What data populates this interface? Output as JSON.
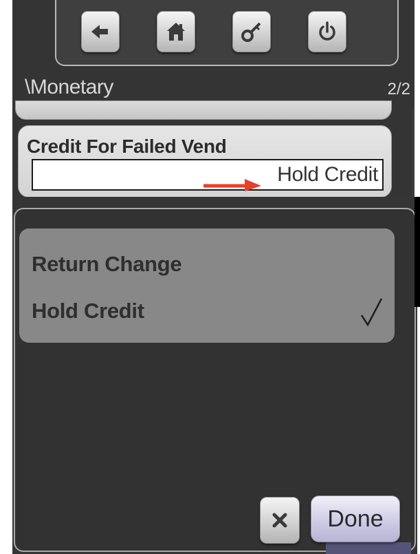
{
  "toolbar": {
    "buttons": [
      {
        "icon": "back-arrow-icon"
      },
      {
        "icon": "home-icon"
      },
      {
        "icon": "key-icon"
      },
      {
        "icon": "power-icon"
      }
    ]
  },
  "header": {
    "breadcrumb": "\\Monetary",
    "page_indicator": "2/2"
  },
  "setting": {
    "label": "Credit For Failed Vend",
    "value": "Hold Credit"
  },
  "annotation": {
    "arrow_color": "#e8402a"
  },
  "popup": {
    "options": [
      {
        "label": "Return Change",
        "selected": false
      },
      {
        "label": "Hold Credit",
        "selected": true
      }
    ],
    "cancel_icon": "close-icon",
    "done_label": "Done"
  }
}
